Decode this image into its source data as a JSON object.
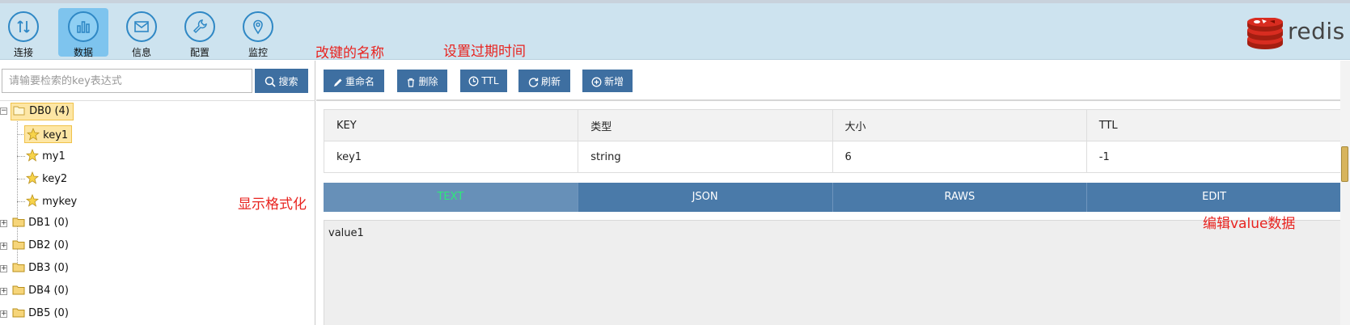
{
  "toolbar": {
    "items": [
      {
        "label": "连接",
        "icon": "connect-arrows-icon"
      },
      {
        "label": "数据",
        "icon": "bar-chart-icon",
        "active": true
      },
      {
        "label": "信息",
        "icon": "envelope-icon"
      },
      {
        "label": "配置",
        "icon": "wrench-icon"
      },
      {
        "label": "监控",
        "icon": "monitor-pin-icon"
      }
    ],
    "logo_text": "redis"
  },
  "annotations": {
    "rename": "改键的名称",
    "ttl": "设置过期时间",
    "format": "显示格式化",
    "edit": "编辑value数据"
  },
  "search": {
    "placeholder": "请输要检索的key表达式",
    "button_label": "搜索"
  },
  "tree": {
    "databases": [
      {
        "label": "DB0 (4)",
        "expanded": true,
        "keys": [
          "key1",
          "my1",
          "key2",
          "mykey"
        ],
        "selected_key": "key1"
      },
      {
        "label": "DB1 (0)"
      },
      {
        "label": "DB2 (0)"
      },
      {
        "label": "DB3 (0)"
      },
      {
        "label": "DB4 (0)"
      },
      {
        "label": "DB5 (0)"
      }
    ]
  },
  "actions": {
    "rename": "重命名",
    "delete": "删除",
    "ttl": "TTL",
    "refresh": "刷新",
    "add": "新增"
  },
  "key_info": {
    "headers": [
      "KEY",
      "类型",
      "大小",
      "TTL"
    ],
    "values": [
      "key1",
      "string",
      "6",
      "-1"
    ]
  },
  "view_tabs": {
    "tabs": [
      "TEXT",
      "JSON",
      "RAWS",
      "EDIT"
    ],
    "active": "TEXT"
  },
  "value": {
    "content": "value1"
  },
  "colors": {
    "toolbar_bg": "#cde3ef",
    "button_blue": "#3e6fa1",
    "tab_blue": "#4a7aa9",
    "annotation_red": "#e8231f",
    "active_tab_text": "#2ee87a"
  }
}
